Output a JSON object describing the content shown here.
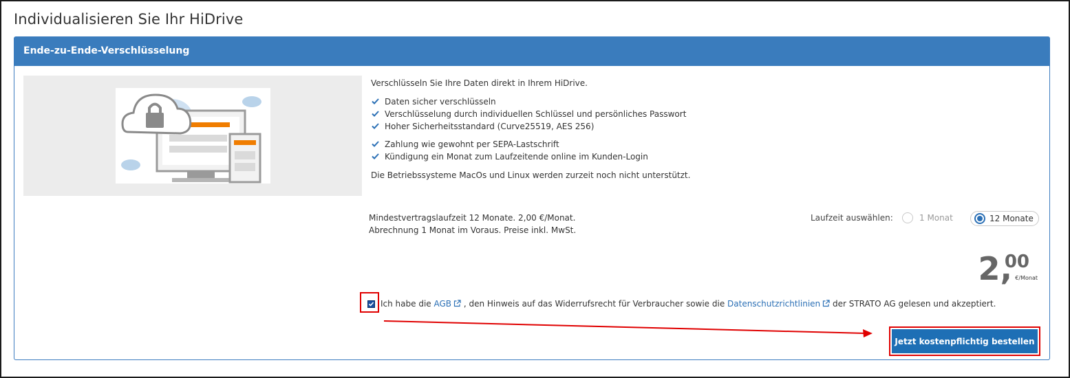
{
  "page": {
    "title": "Individualisieren Sie Ihr HiDrive"
  },
  "panel": {
    "header": "Ende-zu-Ende-Verschlüsselung",
    "intro": "Verschlüsseln Sie Ihre Daten direkt in Ihrem HiDrive.",
    "features_group1": [
      "Daten sicher verschlüsseln",
      "Verschlüsselung durch individuellen Schlüssel und persönliches Passwort",
      "Hoher Sicherheitsstandard (Curve25519, AES 256)"
    ],
    "features_group2": [
      "Zahlung wie gewohnt per SEPA-Lastschrift",
      "Kündigung ein Monat zum Laufzeitende online im Kunden-Login"
    ],
    "note": "Die Betriebssysteme MacOs und Linux werden zurzeit noch nicht unterstützt."
  },
  "terms": {
    "line1": "Mindestvertragslaufzeit 12 Monate. 2,00 €/Monat.",
    "line2": "Abrechnung 1 Monat im Voraus. Preise inkl. MwSt."
  },
  "duration": {
    "label": "Laufzeit auswählen:",
    "options": [
      {
        "label": "1 Monat",
        "selected": false
      },
      {
        "label": "12 Monate",
        "selected": true
      }
    ]
  },
  "price": {
    "integer": "2,",
    "decimal": "00",
    "unit": "€/Monat"
  },
  "consent": {
    "checked": true,
    "text_before": "Ich habe die ",
    "agb_link": "AGB",
    "text_middle": " , den Hinweis auf das Widerrufsrecht für Verbraucher sowie die ",
    "privacy_link": "Datenschutzrichtlinien",
    "text_after": " der STRATO AG gelesen und akzeptiert."
  },
  "order_button": {
    "label": "Jetzt kostenpflichtig bestellen"
  },
  "colors": {
    "header_blue": "#3a7cbd",
    "button_blue": "#1e6fb5",
    "link_blue": "#2a6fb5",
    "annotation_red": "#e00000",
    "accent_orange": "#f07d00"
  }
}
